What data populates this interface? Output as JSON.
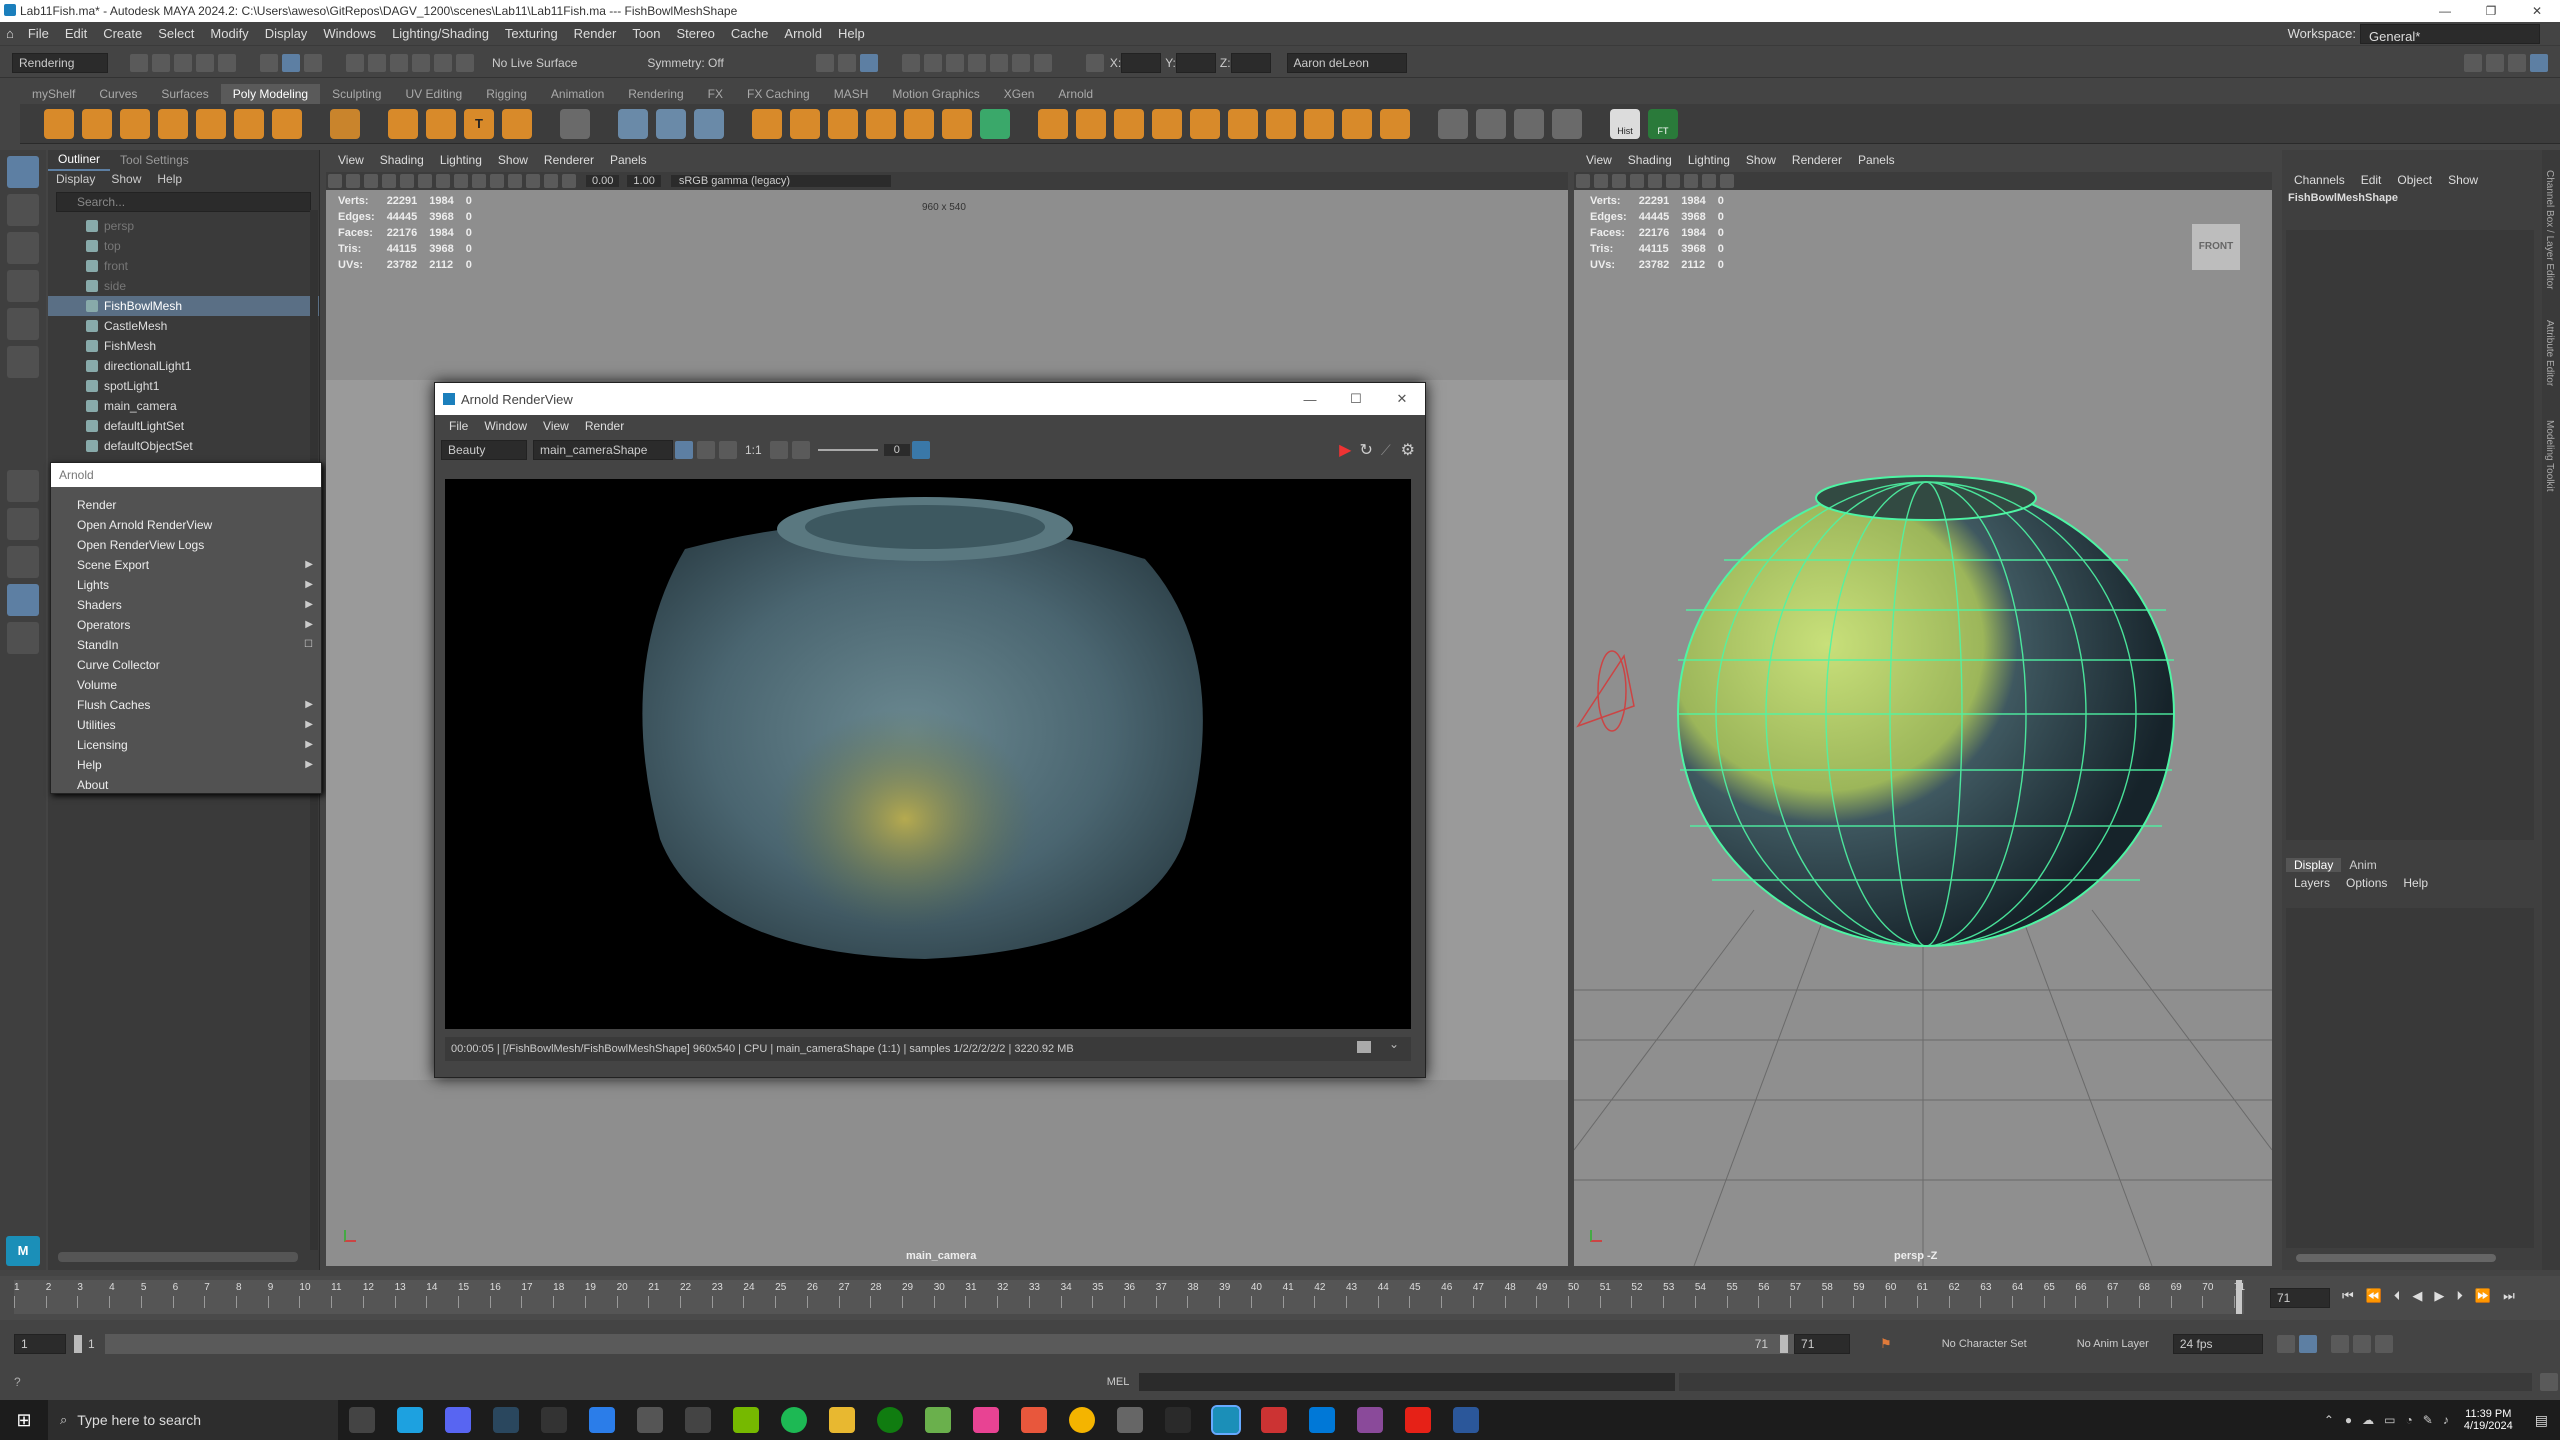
{
  "window": {
    "title": "Lab11Fish.ma* - Autodesk MAYA 2024.2: C:\\Users\\aweso\\GitRepos\\DAGV_1200\\scenes\\Lab11\\Lab11Fish.ma  ---  FishBowlMeshShape"
  },
  "menubar": {
    "items": [
      "File",
      "Edit",
      "Create",
      "Select",
      "Modify",
      "Display",
      "Windows",
      "Lighting/Shading",
      "Texturing",
      "Render",
      "Toon",
      "Stereo",
      "Cache",
      "Arnold",
      "Help"
    ],
    "workspace_label": "Workspace:",
    "workspace_value": "General*"
  },
  "statusline": {
    "menuset": "Rendering",
    "live": "No Live Surface",
    "symmetry": "Symmetry: Off",
    "x_label": "X:",
    "y_label": "Y:",
    "z_label": "Z:",
    "user": "Aaron deLeon"
  },
  "shelf": {
    "tabs": [
      "myShelf",
      "Curves",
      "Surfaces",
      "Poly Modeling",
      "Sculpting",
      "UV Editing",
      "Rigging",
      "Animation",
      "Rendering",
      "FX",
      "FX Caching",
      "MASH",
      "Motion Graphics",
      "XGen",
      "Arnold"
    ],
    "active": "Poly Modeling",
    "hist_label": "Hist",
    "ft_label": "FT"
  },
  "outliner": {
    "tabs": [
      "Outliner",
      "Tool Settings"
    ],
    "menus": [
      "Display",
      "Show",
      "Help"
    ],
    "search_placeholder": "Search...",
    "items": [
      {
        "label": "persp",
        "dim": true
      },
      {
        "label": "top",
        "dim": true
      },
      {
        "label": "front",
        "dim": true
      },
      {
        "label": "side",
        "dim": true
      },
      {
        "label": "FishBowlMesh",
        "selected": true
      },
      {
        "label": "CastleMesh"
      },
      {
        "label": "FishMesh"
      },
      {
        "label": "directionalLight1"
      },
      {
        "label": "spotLight1"
      },
      {
        "label": "main_camera"
      },
      {
        "label": "defaultLightSet"
      },
      {
        "label": "defaultObjectSet"
      }
    ]
  },
  "arnold_menu": {
    "header": "Arnold",
    "items": [
      {
        "label": "Render"
      },
      {
        "label": "Open Arnold RenderView"
      },
      {
        "label": "Open RenderView Logs"
      },
      {
        "label": "Scene Export",
        "sub": true
      },
      {
        "label": "Lights",
        "sub": true
      },
      {
        "label": "Shaders",
        "sub": true
      },
      {
        "label": "Operators",
        "sub": true
      },
      {
        "label": "StandIn",
        "box": true
      },
      {
        "label": "Curve Collector"
      },
      {
        "label": "Volume"
      },
      {
        "label": "Flush Caches",
        "sub": true
      },
      {
        "label": "Utilities",
        "sub": true
      },
      {
        "label": "Licensing",
        "sub": true
      },
      {
        "label": "Help",
        "sub": true
      },
      {
        "label": "About"
      }
    ]
  },
  "viewport_left": {
    "menus": [
      "View",
      "Shading",
      "Lighting",
      "Show",
      "Renderer",
      "Panels"
    ],
    "near": "0.00",
    "far": "1.00",
    "colorspace": "sRGB gamma (legacy)",
    "resolution": "960 x 540",
    "camera": "main_camera",
    "hud": [
      [
        "Verts:",
        "22291",
        "1984",
        "0"
      ],
      [
        "Edges:",
        "44445",
        "3968",
        "0"
      ],
      [
        "Faces:",
        "22176",
        "1984",
        "0"
      ],
      [
        "Tris:",
        "44115",
        "3968",
        "0"
      ],
      [
        "UVs:",
        "23782",
        "2112",
        "0"
      ]
    ]
  },
  "viewport_right": {
    "menus": [
      "View",
      "Shading",
      "Lighting",
      "Show",
      "Renderer",
      "Panels"
    ],
    "camera": "persp -Z",
    "cube_label": "FRONT",
    "hud": [
      [
        "Verts:",
        "22291",
        "1984",
        "0"
      ],
      [
        "Edges:",
        "44445",
        "3968",
        "0"
      ],
      [
        "Faces:",
        "22176",
        "1984",
        "0"
      ],
      [
        "Tris:",
        "44115",
        "3968",
        "0"
      ],
      [
        "UVs:",
        "23782",
        "2112",
        "0"
      ]
    ]
  },
  "renderview": {
    "title": "Arnold RenderView",
    "menus": [
      "File",
      "Window",
      "View",
      "Render"
    ],
    "aov": "Beauty",
    "camera": "main_cameraShape",
    "ratio": "1:1",
    "exposure": "0",
    "status": "00:00:05 |    [/FishBowlMesh/FishBowlMeshShape]  960x540 | CPU | main_cameraShape (1:1) | samples 1/2/2/2/2/2 | 3220.92 MB"
  },
  "channelbox": {
    "menus": [
      "Channels",
      "Edit",
      "Object",
      "Show"
    ],
    "object": "FishBowlMeshShape",
    "layer_tabs": [
      "Display",
      "Anim"
    ],
    "layer_menus": [
      "Layers",
      "Options",
      "Help"
    ],
    "side_tabs": [
      "Channel Box / Layer Editor",
      "Attribute Editor",
      "Modeling Toolkit"
    ]
  },
  "timeline": {
    "ticks": [
      "1",
      "2",
      "3",
      "4",
      "5",
      "6",
      "7",
      "8",
      "9",
      "10",
      "11",
      "12",
      "13",
      "14",
      "15",
      "16",
      "17",
      "18",
      "19",
      "20",
      "21",
      "22",
      "23",
      "24",
      "25",
      "26",
      "27",
      "28",
      "29",
      "30",
      "31",
      "32",
      "33",
      "34",
      "35",
      "36",
      "37",
      "38",
      "39",
      "40",
      "41",
      "42",
      "43",
      "44",
      "45",
      "46",
      "47",
      "48",
      "49",
      "50",
      "51",
      "52",
      "53",
      "54",
      "55",
      "56",
      "57",
      "58",
      "59",
      "60",
      "61",
      "62",
      "63",
      "64",
      "65",
      "66",
      "67",
      "68",
      "69",
      "70",
      "71"
    ],
    "current": "71",
    "current_field": "71"
  },
  "range": {
    "start": "1",
    "start2": "1",
    "end": "71",
    "end2": "71",
    "charset": "No Character Set",
    "animlayer": "No Anim Layer",
    "fps": "24 fps"
  },
  "cmdline": {
    "label": "MEL"
  },
  "taskbar": {
    "search": "Type here to search",
    "time": "11:39 PM",
    "date": "4/19/2024"
  }
}
